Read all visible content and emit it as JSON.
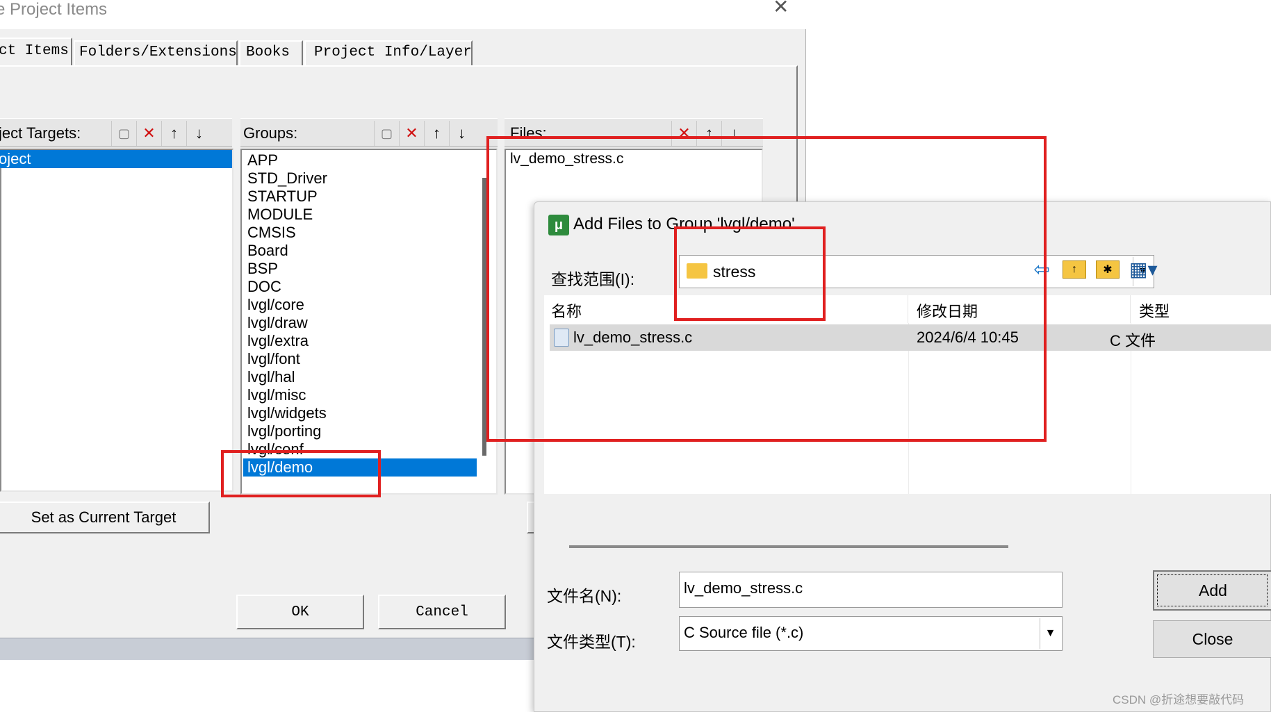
{
  "manage_dialog": {
    "title": "e Project Items",
    "close_glyph": "✕",
    "tabs": [
      {
        "label": "ct Items",
        "active": true
      },
      {
        "label": "Folders/Extensions",
        "active": false
      },
      {
        "label": "Books",
        "active": false
      },
      {
        "label": "Project Info/Layer",
        "active": false
      }
    ],
    "targets_label": "ject Targets:",
    "targets": [
      "oject"
    ],
    "groups_label": "Groups:",
    "groups": [
      "APP",
      "STD_Driver",
      "STARTUP",
      "MODULE",
      "CMSIS",
      "Board",
      "BSP",
      "DOC",
      "lvgl/core",
      "lvgl/draw",
      "lvgl/extra",
      "lvgl/font",
      "lvgl/hal",
      "lvgl/misc",
      "lvgl/widgets",
      "lvgl/porting",
      "lvgl/conf",
      "lvgl/demo"
    ],
    "selected_group": "lvgl/demo",
    "files_label": "Files:",
    "files": [
      "lv_demo_stress.c"
    ],
    "set_current_label": "Set as Current Target",
    "ok_label": "OK",
    "cancel_label": "Cancel"
  },
  "add_dialog": {
    "title": "Add Files to Group 'lvgl/demo'",
    "lookin_label": "查找范围(I):",
    "current_folder": "stress",
    "columns": {
      "name": "名称",
      "date": "修改日期",
      "type": "类型"
    },
    "rows": [
      {
        "name": "lv_demo_stress.c",
        "date": "2024/6/4 10:45",
        "type": "C 文件"
      }
    ],
    "filename_label": "文件名(N):",
    "filename_value": "lv_demo_stress.c",
    "filetype_label": "文件类型(T):",
    "filetype_value": "C Source file (*.c)",
    "add_label": "Add",
    "close_label": "Close"
  },
  "watermark": "CSDN @折途想要敲代码",
  "colors": {
    "highlight": "#0078d7",
    "annotation": "#e02020",
    "dialog_bg": "#f0f0f0"
  }
}
